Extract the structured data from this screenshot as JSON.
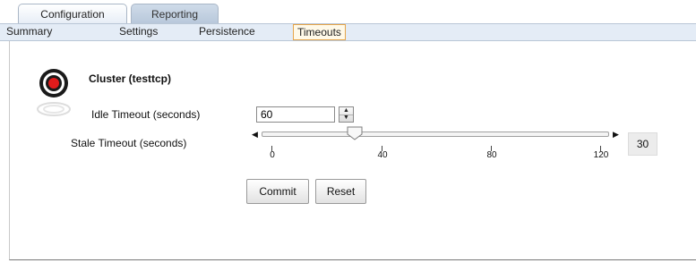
{
  "tabs": {
    "top": [
      {
        "label": "Configuration",
        "active": true
      },
      {
        "label": "Reporting",
        "active": false
      }
    ],
    "sub": [
      {
        "label": "Summary",
        "selected": false
      },
      {
        "label": "Settings",
        "selected": false
      },
      {
        "label": "Persistence",
        "selected": false
      },
      {
        "label": "Timeouts",
        "selected": true
      }
    ]
  },
  "cluster": {
    "title": "Cluster (testtcp)",
    "icon": "target-icon"
  },
  "idle_timeout": {
    "label": "Idle Timeout (seconds)",
    "value": "60"
  },
  "stale_timeout": {
    "label": "Stale Timeout (seconds)",
    "min": 0,
    "max": 120,
    "ticks": [
      "0",
      "40",
      "80",
      "120"
    ],
    "value": "30"
  },
  "buttons": {
    "commit": "Commit",
    "reset": "Reset"
  },
  "colors": {
    "selected_tab_border": "#e6a54a",
    "tab_bar_bg": "#e4ecf6",
    "target_red": "#e01b1b"
  }
}
